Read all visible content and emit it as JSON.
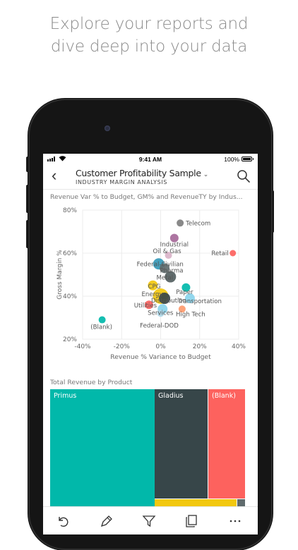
{
  "headline": {
    "line1": "Explore your reports and",
    "line2": "dive deep into your data"
  },
  "status_bar": {
    "time": "9:41 AM",
    "battery": "100%"
  },
  "header": {
    "title": "Customer Profitability Sample",
    "subtitle": "INDUSTRY MARGIN ANALYSIS"
  },
  "scatter_visual": {
    "title": "Revenue Var % to Budget, GM% and RevenueTY by Indus...",
    "xlabel": "Revenue % Variance to Budget",
    "ylabel": "Gross Margin %"
  },
  "treemap_visual": {
    "title": "Total Revenue by Product"
  },
  "colors": {
    "teal": "#01B8AA",
    "dark": "#374649",
    "red": "#FD625E",
    "yellow": "#F2C80F",
    "grey": "#8A8A8A",
    "purple": "#A66999",
    "light_blue": "#8AD4EB",
    "blue": "#3599B8"
  },
  "chart_data": [
    {
      "type": "scatter",
      "title": "Revenue Var % to Budget, GM% and RevenueTY by Indus...",
      "xlabel": "Revenue % Variance to Budget",
      "ylabel": "Gross Margin %",
      "xlim": [
        -40,
        40
      ],
      "ylim": [
        20,
        80
      ],
      "x_ticks": [
        "-40%",
        "-20%",
        "0%",
        "20%",
        "40%"
      ],
      "y_ticks": [
        "20%",
        "40%",
        "60%",
        "80%"
      ],
      "grid": true,
      "points": [
        {
          "label": "Telecom",
          "x": 10,
          "y": 74,
          "r": 5,
          "color": "#7F7F7F"
        },
        {
          "label": "Industrial",
          "x": 7,
          "y": 67,
          "r": 6,
          "color": "#A66999"
        },
        {
          "label": "Oil & Gas",
          "x": 4,
          "y": 59,
          "r": 5,
          "color": "#D9B3C8"
        },
        {
          "label": "Retail",
          "x": 37,
          "y": 60,
          "r": 4.5,
          "color": "#FD625E"
        },
        {
          "label": "Federal-Civilian",
          "x": -1,
          "y": 55,
          "r": 8,
          "color": "#3599B8"
        },
        {
          "label": "Pharma",
          "x": 2,
          "y": 53,
          "r": 7,
          "color": "#5F6B6D"
        },
        {
          "label": "Metal",
          "x": 5,
          "y": 49,
          "r": 8,
          "color": "#545F61"
        },
        {
          "label": "CPG",
          "x": -4,
          "y": 45,
          "r": 7,
          "color": "#F2C80F"
        },
        {
          "label": "Paper",
          "x": 13,
          "y": 44,
          "r": 6,
          "color": "#01B8AA"
        },
        {
          "label": "Energy",
          "x": 0,
          "y": 40,
          "r": 11,
          "color": "#F2C80F"
        },
        {
          "label": "Transportation",
          "x": 15,
          "y": 39,
          "r": 7,
          "color": "#8AD4EB"
        },
        {
          "label": "Utilities",
          "x": -6,
          "y": 36,
          "r": 6,
          "color": "#FD625E"
        },
        {
          "label": "Distribution",
          "x": 2,
          "y": 39,
          "r": 8,
          "color": "#374649"
        },
        {
          "label": "Services",
          "x": 1,
          "y": 34,
          "r": 7,
          "color": "#8AD4EB"
        },
        {
          "label": "High Tech",
          "x": 11,
          "y": 34,
          "r": 5,
          "color": "#FD9A6E"
        },
        {
          "label": "Federal-DOD",
          "x": 0,
          "y": 32,
          "r": 5,
          "color": "#B0D8E8"
        },
        {
          "label": "(Blank)",
          "x": -30,
          "y": 29,
          "r": 5,
          "color": "#01B8AA"
        }
      ]
    },
    {
      "type": "treemap",
      "title": "Total Revenue by Product",
      "items": [
        {
          "label": "Primus",
          "color": "#01B8AA"
        },
        {
          "label": "Gladius",
          "color": "#374649"
        },
        {
          "label": "(Blank)",
          "color": "#FD625E"
        }
      ]
    }
  ]
}
